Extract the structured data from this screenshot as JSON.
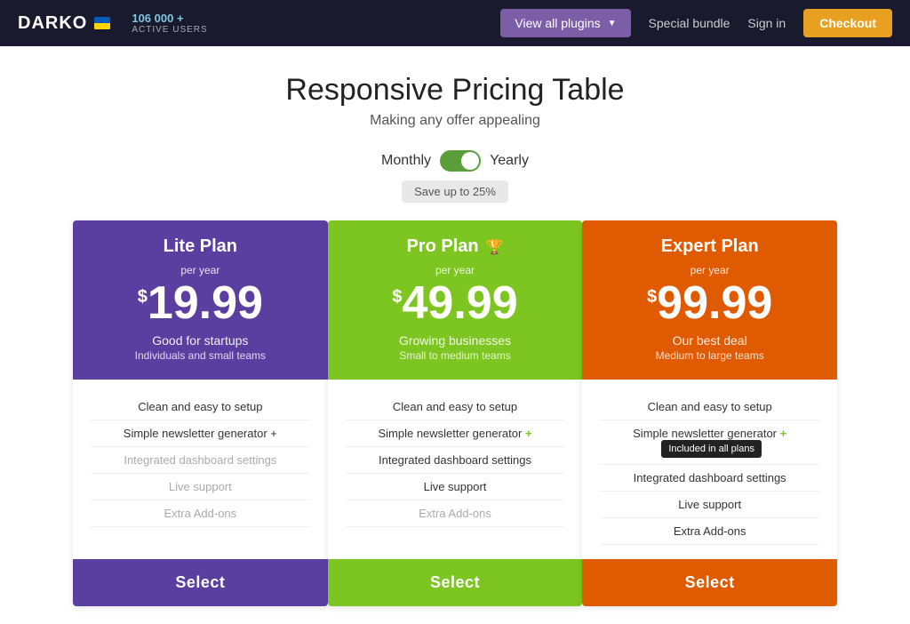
{
  "header": {
    "logo": "DARKO",
    "active_count": "106 000 +",
    "active_label": "ACTIVE USERS",
    "view_plugins_label": "View all plugins",
    "special_bundle_label": "Special bundle",
    "sign_in_label": "Sign in",
    "checkout_label": "Checkout"
  },
  "main": {
    "title": "Responsive Pricing Table",
    "subtitle": "Making any offer appealing",
    "toggle": {
      "monthly_label": "Monthly",
      "yearly_label": "Yearly",
      "save_badge": "Save up to 25%"
    }
  },
  "plans": [
    {
      "id": "lite",
      "name": "Lite Plan",
      "icon": null,
      "per_year": "per year",
      "currency": "$",
      "price": "19.99",
      "tagline": "Good for startups",
      "description": "Individuals and small teams",
      "features": [
        {
          "text": "Clean and easy to setup",
          "muted": false
        },
        {
          "text": "Simple newsletter generator +",
          "muted": false,
          "plus": true
        },
        {
          "text": "Integrated dashboard settings",
          "muted": true
        },
        {
          "text": "Live support",
          "muted": true
        },
        {
          "text": "Extra Add-ons",
          "muted": true
        }
      ],
      "select_label": "Select",
      "color_class": "lite"
    },
    {
      "id": "pro",
      "name": "Pro Plan",
      "icon": "trophy",
      "per_year": "per year",
      "currency": "$",
      "price": "49.99",
      "tagline": "Growing businesses",
      "description": "Small to medium teams",
      "features": [
        {
          "text": "Clean and easy to setup",
          "muted": false
        },
        {
          "text": "Simple newsletter generator +",
          "muted": false,
          "plus": true
        },
        {
          "text": "Integrated dashboard settings",
          "muted": false
        },
        {
          "text": "Live support",
          "muted": false
        },
        {
          "text": "Extra Add-ons",
          "muted": true
        }
      ],
      "select_label": "Select",
      "color_class": "pro"
    },
    {
      "id": "expert",
      "name": "Expert Plan",
      "icon": null,
      "per_year": "per year",
      "currency": "$",
      "price": "99.99",
      "tagline": "Our best deal",
      "description": "Medium to large teams",
      "features": [
        {
          "text": "Clean and easy to setup",
          "muted": false
        },
        {
          "text": "Simple newsletter generator +",
          "muted": false,
          "plus": true,
          "tooltip": "Included in all plans"
        },
        {
          "text": "Integrated dashboard settings",
          "muted": false
        },
        {
          "text": "Live support",
          "muted": false
        },
        {
          "text": "Extra Add-ons",
          "muted": false
        }
      ],
      "select_label": "Select",
      "color_class": "expert"
    }
  ],
  "tooltip": {
    "text": "Included in all plans"
  }
}
